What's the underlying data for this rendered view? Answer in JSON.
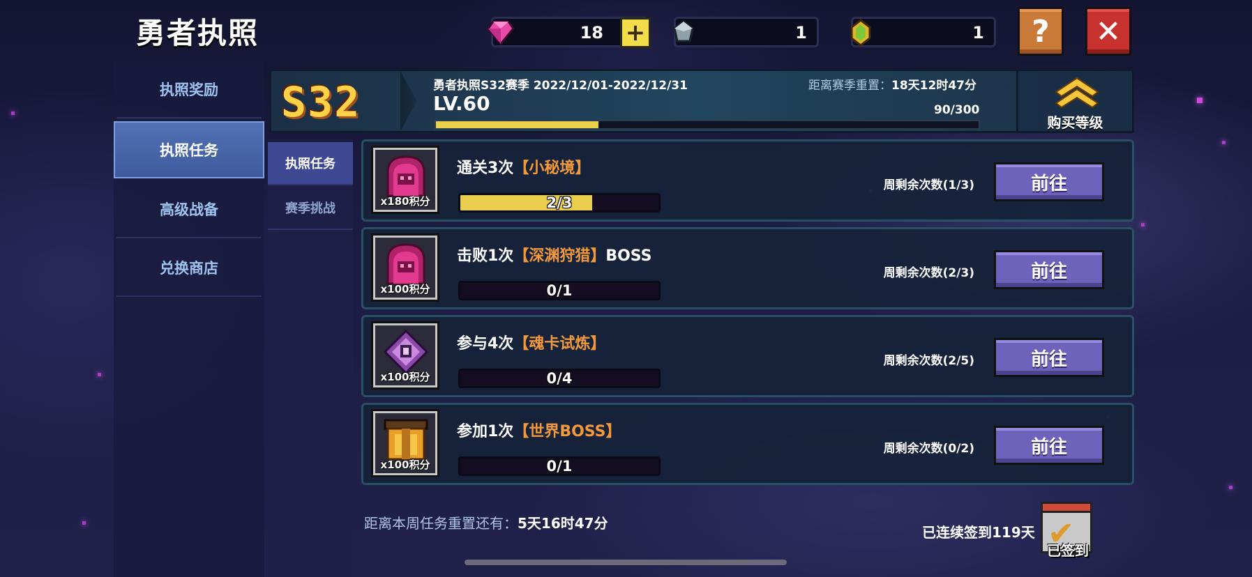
{
  "header": {
    "title": "勇者执照",
    "resources": [
      {
        "icon": "gem-icon",
        "value": "18",
        "has_plus": true,
        "plus_label": "+"
      },
      {
        "icon": "crystal-icon",
        "value": "1"
      },
      {
        "icon": "gold-gem-icon",
        "value": "1"
      }
    ],
    "help_label": "?",
    "close_label": "✕"
  },
  "sidebar": {
    "items": [
      {
        "label": "执照奖励",
        "active": false
      },
      {
        "label": "执照任务",
        "active": true
      },
      {
        "label": "高级战备",
        "active": false
      },
      {
        "label": "兑换商店",
        "active": false
      }
    ]
  },
  "season": {
    "badge": "S32",
    "name": "勇者执照S32赛季 2022/12/01-2022/12/31",
    "level": "LV.60",
    "reset_label": "距离赛季重置：",
    "reset_time": "18天12时47分",
    "exp": "90/300",
    "exp_progress": 0.3,
    "buy_level_label": "购买等级"
  },
  "subtabs": [
    {
      "label": "执照任务",
      "active": true
    },
    {
      "label": "赛季挑战",
      "active": false
    }
  ],
  "tasks": [
    {
      "prefix": "通关3次",
      "highlight": "【小秘境】",
      "suffix": "",
      "points": "x180积分",
      "icon": "ghost-icon",
      "progress_text": "2/3",
      "progress": 0.667,
      "remaining": "周剩余次数(1/3)",
      "button": "前往"
    },
    {
      "prefix": "击败1次",
      "highlight": "【深渊狩猎】",
      "suffix": "BOSS",
      "points": "x100积分",
      "icon": "ghost-icon",
      "progress_text": "0/1",
      "progress": 0,
      "remaining": "周剩余次数(2/3)",
      "button": "前往"
    },
    {
      "prefix": "参与4次",
      "highlight": "【魂卡试炼】",
      "suffix": "",
      "points": "x100积分",
      "icon": "soul-card-icon",
      "progress_text": "0/4",
      "progress": 0,
      "remaining": "周剩余次数(2/5)",
      "button": "前往"
    },
    {
      "prefix": "参加1次",
      "highlight": "【世界BOSS】",
      "suffix": "",
      "points": "x100积分",
      "icon": "chest-icon",
      "progress_text": "0/1",
      "progress": 0,
      "remaining": "周剩余次数(0/2)",
      "button": "前往"
    }
  ],
  "footer": {
    "weekly_reset_label": "距离本周任务重置还有：",
    "weekly_reset_time": "5天16时47分",
    "streak": "已连续签到119天",
    "checkin_label": "已签到",
    "checkin_icon": "calendar-check-icon"
  },
  "colors": {
    "highlight": "#f29a3b",
    "progress": "#e9ce4d",
    "button": "#6e62ba",
    "active_tab": "#4a66ab"
  }
}
